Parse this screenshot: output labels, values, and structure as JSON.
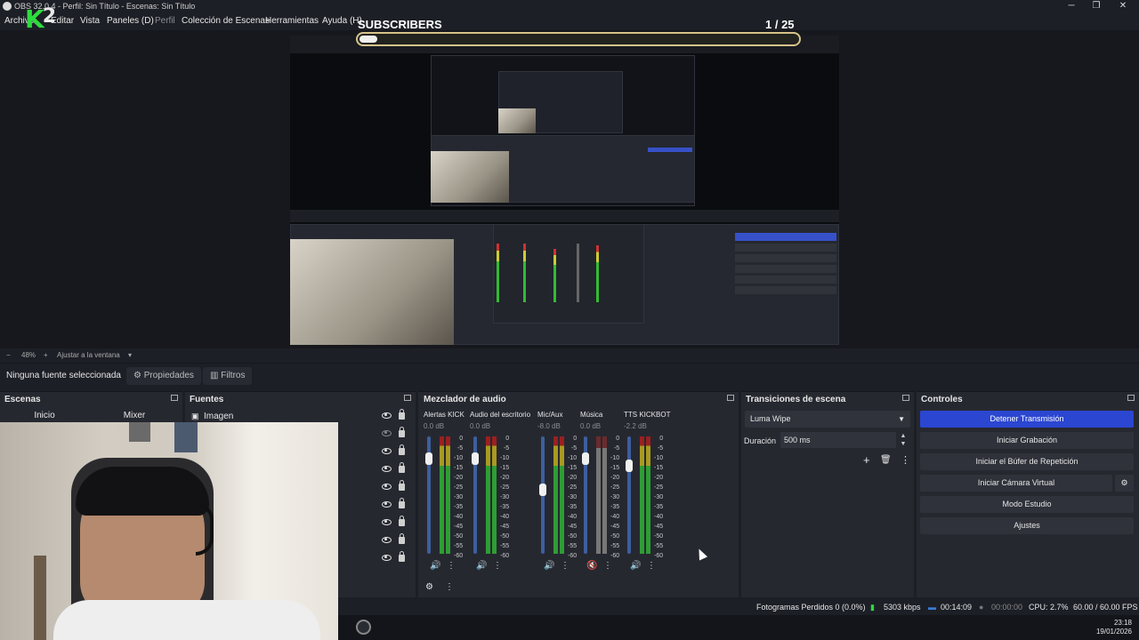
{
  "window": {
    "title": "OBS 32.0.4 - Perfil: Sin Título - Escenas: Sin Título",
    "minimize": "─",
    "maximize": "❐",
    "close": "✕"
  },
  "menu": [
    "Archivo",
    "Editar",
    "Vista",
    "Paneles (D)",
    "Perfil",
    "Colección de Escenas",
    "Herramientas",
    "Ayuda (H)"
  ],
  "overlay": {
    "logo": "K",
    "logo_suffix": "2",
    "subscribers_label": "SUBSCRIBERS",
    "subscribers_count": "1 / 25",
    "subscribers_progress": 0.04
  },
  "zoom": {
    "minus": "−",
    "value": "48%",
    "plus": "+",
    "fit": "Ajustar a la ventana"
  },
  "props": {
    "no_source": "Ninguna fuente seleccionada",
    "properties": "Propiedades",
    "filters": "Filtros"
  },
  "scenes": {
    "title": "Escenas",
    "items": [
      "Inicio",
      "Mixer"
    ]
  },
  "sources": {
    "title": "Fuentes",
    "items": [
      "Imagen"
    ]
  },
  "mixer": {
    "title": "Mezclador de audio",
    "channels": [
      {
        "name": "Alertas KICK",
        "db": "0.0 dB",
        "level": 0.85,
        "muted": false
      },
      {
        "name": "Audio del escritorio",
        "db": "0.0 dB",
        "level": 0.85,
        "muted": false
      },
      {
        "name": "Mic/Aux",
        "db": "-8.0 dB",
        "level": 0.55,
        "muted": false
      },
      {
        "name": "Música",
        "db": "0.0 dB",
        "level": 0.85,
        "muted": true
      },
      {
        "name": "TTS KICKBOT",
        "db": "-2.2 dB",
        "level": 0.78,
        "muted": false
      }
    ],
    "scale": [
      "0",
      "-5",
      "-10",
      "-15",
      "-20",
      "-25",
      "-30",
      "-35",
      "-40",
      "-45",
      "-50",
      "-55",
      "-60"
    ]
  },
  "transitions": {
    "title": "Transiciones de escena",
    "selected": "Luma Wipe",
    "duration_label": "Duración",
    "duration": "500 ms",
    "add": "+",
    "remove": "🗑",
    "more": "⋮"
  },
  "controls": {
    "title": "Controles",
    "buttons": [
      "Detener Transmisión",
      "Iniciar Grabación",
      "Iniciar el Búfer de Repetición",
      "Iniciar Cámara Virtual",
      "Modo Estudio",
      "Ajustes"
    ]
  },
  "status": {
    "dropped": "Fotogramas Perdidos 0 (0.0%)",
    "bitrate": "5303 kbps",
    "stream_time": "00:14:09",
    "rec_time": "00:00:00",
    "cpu": "CPU: 2.7%",
    "fps": "60.00 / 60.00 FPS"
  },
  "clock": {
    "time": "23:18",
    "date": "19/01/2026"
  },
  "colors": {
    "accent": "#2b46d1",
    "green": "#2ddc3e",
    "bg": "#1d1f26",
    "dock": "#262830"
  }
}
